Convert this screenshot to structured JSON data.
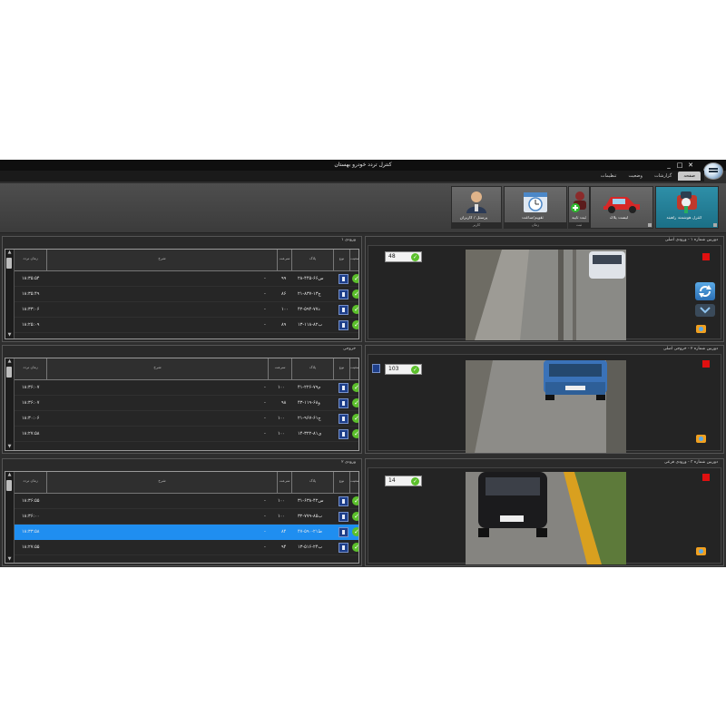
{
  "window": {
    "title": "کنترل تردد خودرو بهستان",
    "controls": [
      "_",
      "□",
      "✕"
    ]
  },
  "menu": {
    "tabs": [
      {
        "label": "صفحه",
        "active": true
      },
      {
        "label": "گزارشات",
        "active": false
      },
      {
        "label": "وضعیت",
        "active": false
      },
      {
        "label": "تنظیمات",
        "active": false
      }
    ]
  },
  "ribbon": {
    "buttons": [
      {
        "label": "کنترل هوشمند راهبند",
        "sub": "",
        "active": true,
        "icon": "camera-car-icon"
      },
      {
        "label": "لیست پلاک",
        "sub": "",
        "active": false,
        "icon": "cars-icon"
      },
      {
        "label": "ثبت تأیید",
        "sub": "ثبت",
        "active": false,
        "icon": "add-person-icon"
      },
      {
        "label": "تقویم/ساعت",
        "sub": "زمان",
        "active": false,
        "icon": "clock-calendar-icon"
      },
      {
        "label": "پرسنل / کاربران",
        "sub": "کاربر",
        "active": false,
        "icon": "users-icon"
      }
    ]
  },
  "lanes": [
    {
      "list_title": "ورودی ۱",
      "headers": {
        "status": "وضعیت",
        "type": "نوع",
        "plate": "پلاک",
        "speed": "سرعت",
        "desc": "شرح",
        "time": "زمان تردد"
      },
      "rows": [
        {
          "plate": "۲۸-۴۴۵-س۶۶",
          "speed": "۹۹",
          "dash": "-",
          "time": "۱۸:۳۵:۵۴"
        },
        {
          "plate": "۲۱-۸۳۷-ج۱۳",
          "speed": "۸۶",
          "dash": "-",
          "time": "۱۸:۳۵:۴۹"
        },
        {
          "plate": "۴۲-۵۹۴-د۷۷",
          "speed": "۱۰۰",
          "dash": "-",
          "time": "۱۸:۳۳:۰۶"
        },
        {
          "plate": "۱۳-۱۱۸-ب۸۲",
          "speed": "۸۹",
          "dash": "-",
          "time": "۱۸:۲۵:۰۹"
        }
      ],
      "camera_title": "دوربین شماره ۱ - ورودی اصلی",
      "speed": "48",
      "selected_row": -1
    },
    {
      "list_title": "خروجی",
      "headers": {
        "status": "وضعیت",
        "type": "نوع",
        "plate": "پلاک",
        "speed": "سرعت",
        "desc": "شرح",
        "time": "زمان تردد"
      },
      "rows": [
        {
          "plate": "۴۱-۲۲۶-م۷۹",
          "speed": "۱۰۰",
          "dash": "-",
          "time": "۱۸:۳۶:۰۷"
        },
        {
          "plate": "۴۳-۱۱۹-و۶۸",
          "speed": "۹۸",
          "dash": "-",
          "time": "۱۸:۳۶:۰۷"
        },
        {
          "plate": "۲۱-۹۶۷-ج۶۱",
          "speed": "۱۰۰",
          "dash": "-",
          "time": "۱۸:۳۰:۰۶"
        },
        {
          "plate": "۱۴-۳۲۲-ی۸۱",
          "speed": "۱۰۰",
          "dash": "-",
          "time": "۱۸:۲۷:۵۸"
        }
      ],
      "camera_title": "دوربین شماره ۲ - خروجی اصلی",
      "speed": "103",
      "selected_row": -1
    },
    {
      "list_title": "ورودی ۲",
      "headers": {
        "status": "وضعیت",
        "type": "نوع",
        "plate": "پلاک",
        "speed": "سرعت",
        "desc": "شرح",
        "time": "زمان تردد"
      },
      "rows": [
        {
          "plate": "۳۱-۶۳۸-س۴۲",
          "speed": "۱۰۰",
          "dash": "-",
          "time": "۱۸:۳۶:۵۵"
        },
        {
          "plate": "۳۲-۷۷۹-ب۸۵",
          "speed": "۱۰۰",
          "dash": "-",
          "time": "۱۸:۳۶:۰۰"
        },
        {
          "plate": "۴۷-۵۹۰-ط۲۱",
          "speed": "۸۴",
          "dash": "-",
          "time": "۱۸:۳۳:۵۸"
        },
        {
          "plate": "۱۳-۵۱۶-ب۲۴",
          "speed": "۹۴",
          "dash": "-",
          "time": "۱۸:۲۷:۵۵"
        }
      ],
      "camera_title": "دوربین شماره ۳ - ورودی فرعی",
      "speed": "14",
      "selected_row": 2
    }
  ],
  "colors": {
    "accent": "#1f8ef0",
    "ok": "#5bbf2b",
    "alarm": "#e01010",
    "ribbon_active": "#2e8fa8"
  }
}
